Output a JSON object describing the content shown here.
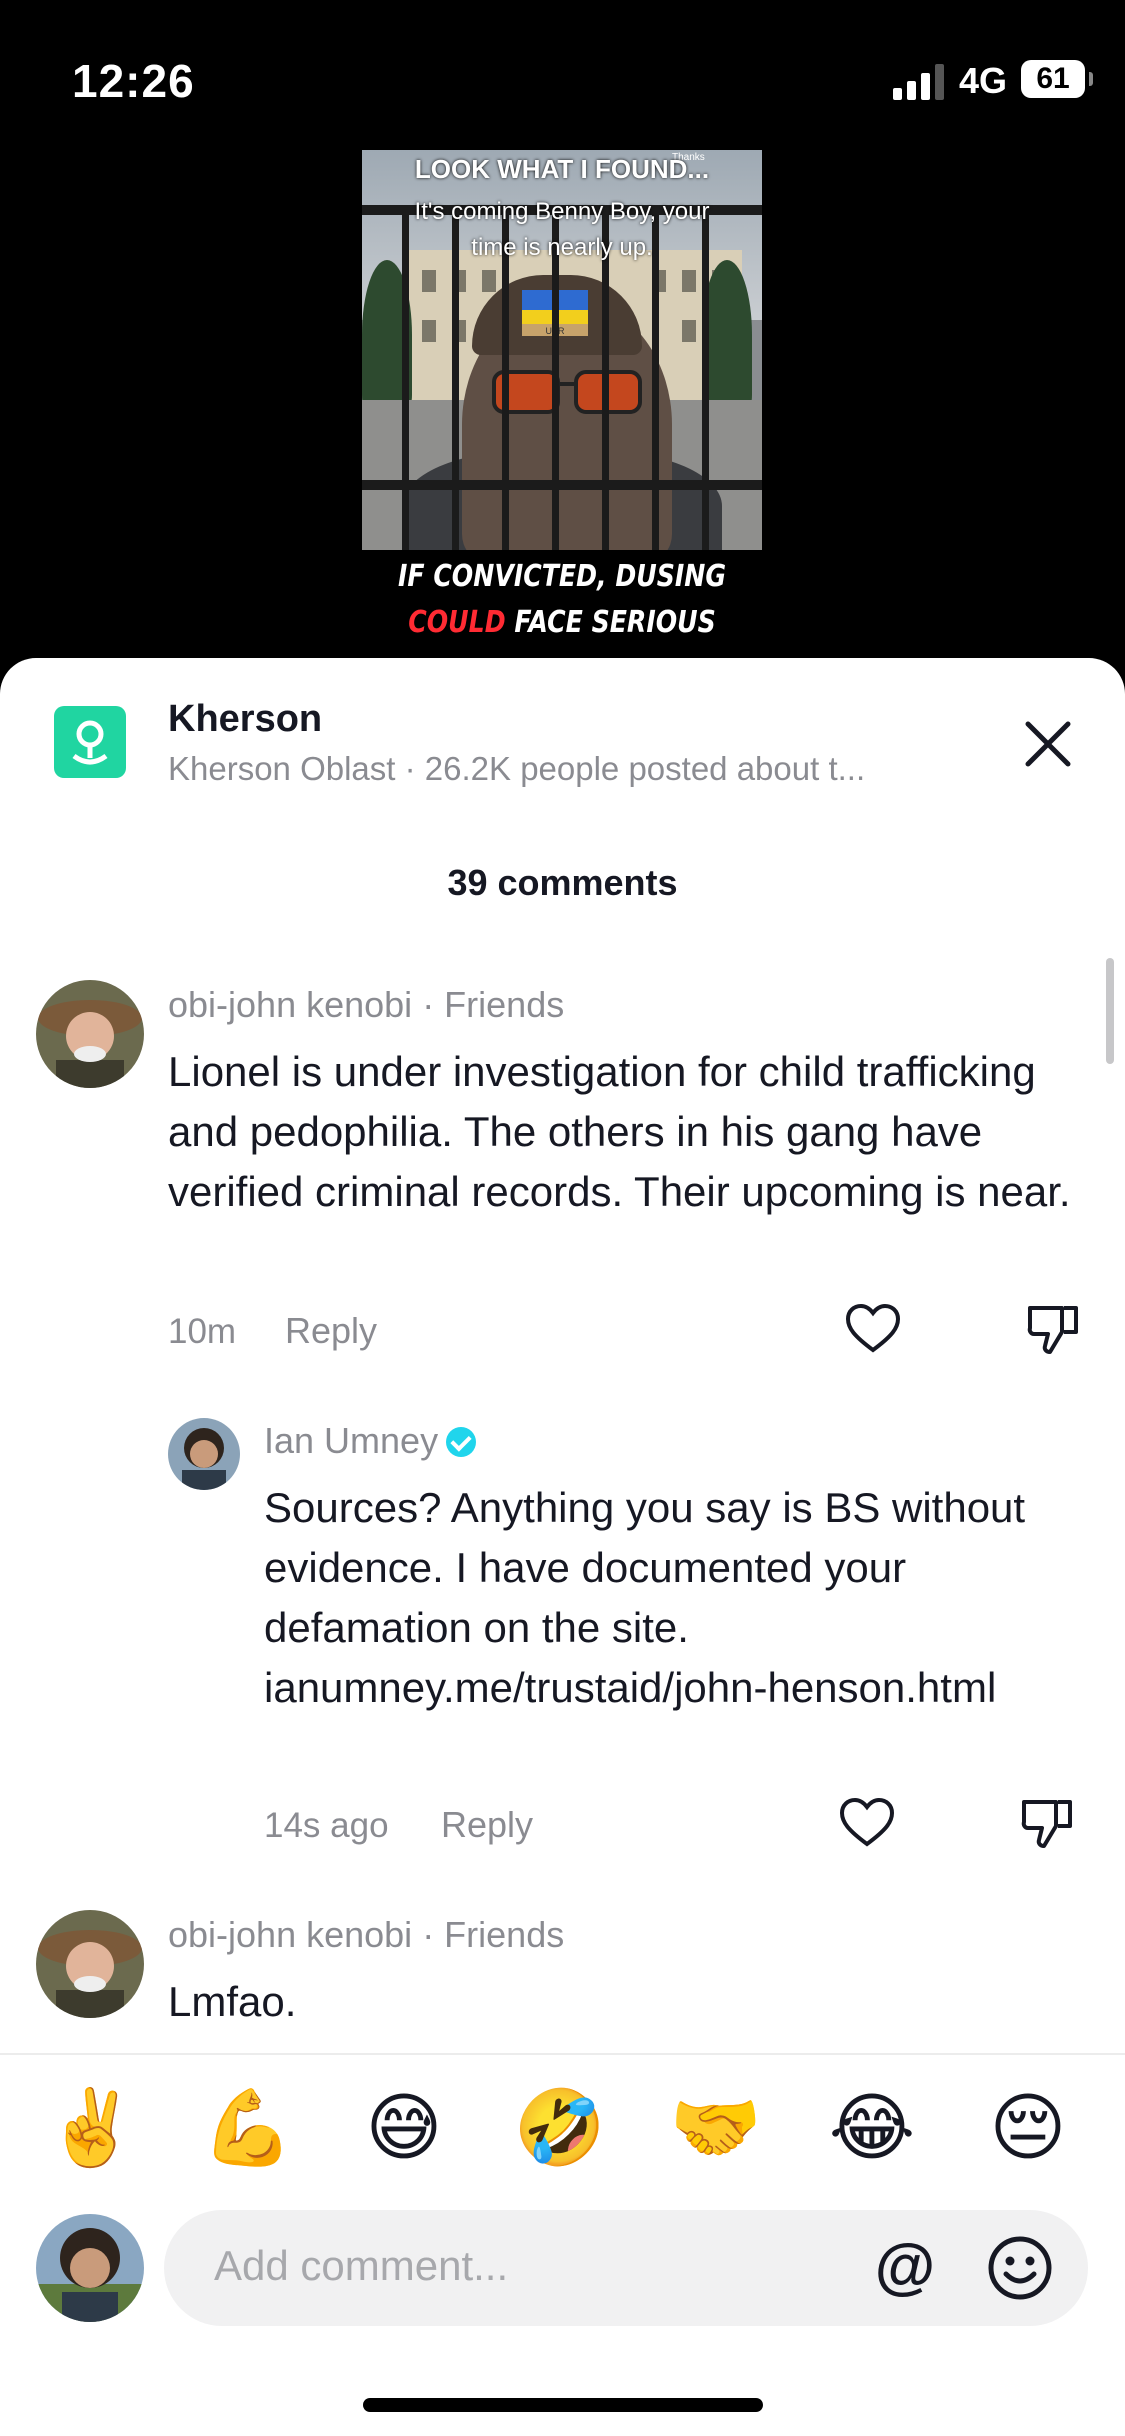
{
  "status": {
    "time": "12:26",
    "network": "4G",
    "battery": "61"
  },
  "video": {
    "caption_line1": "LOOK WHAT I FOUND...",
    "caption_line2": "It's coming Benny Boy, your",
    "caption_line3": "time is nearly up.",
    "thanks": "Thanks",
    "hat_text": "UKR",
    "headline_line1": "IF CONVICTED, DUSING",
    "headline_red": "COULD",
    "headline_rest": " FACE SERIOUS"
  },
  "anchor": {
    "title": "Kherson",
    "subtitle": "Kherson Oblast · 26.2K people posted about t..."
  },
  "comments_count": "39 comments",
  "comments": [
    {
      "author": "obi-john kenobi",
      "tag": " · Friends",
      "text": "Lionel is under investigation for child trafficking and pedophilia. The others in his gang have verified criminal records. Their upcoming is near.",
      "time": "10m",
      "reply_label": "Reply"
    },
    {
      "author": "Ian Umney",
      "text": "Sources? Anything you say is BS without evidence. I have documented your defamation on the site. ianumney.me/trustaid/john-henson.html",
      "time": "14s ago",
      "reply_label": "Reply"
    },
    {
      "author": "obi-john kenobi",
      "tag": " · Friends",
      "text": "Lmfao."
    }
  ],
  "emojis": [
    "✌️",
    "💪",
    "😅",
    "🤣",
    "🤝",
    "😂",
    "😔"
  ],
  "input": {
    "placeholder": "Add comment...",
    "mention": "@"
  },
  "colors": {
    "accent": "#20d5a1",
    "verified": "#20d5ec",
    "headline_red": "#ff2b33"
  }
}
